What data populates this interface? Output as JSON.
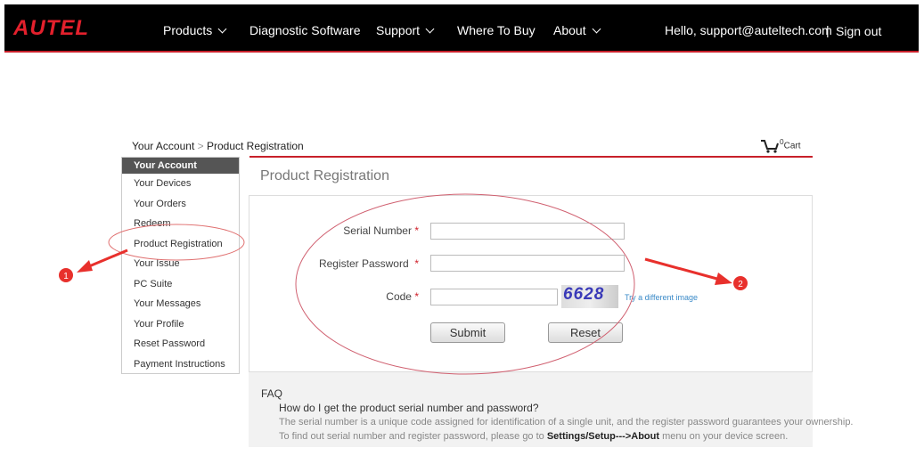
{
  "header": {
    "logo": "AUTEL",
    "nav": [
      "Products",
      "Diagnostic Software",
      "Support",
      "Where To Buy",
      "About"
    ],
    "greeting": "Hello, support@auteltech.com",
    "separator": "|",
    "signout": "Sign out"
  },
  "breadcrumb": {
    "root": "Your Account",
    "sep": ">",
    "current": "Product Registration"
  },
  "cart": {
    "count": "0",
    "label": "Cart"
  },
  "sidebar": {
    "heading": "Your Account",
    "items": [
      "Your Devices",
      "Your Orders",
      "Redeem",
      "Product Registration",
      "Your Issue",
      "PC Suite",
      "Your Messages",
      "Your Profile",
      "Reset Password",
      "Payment Instructions"
    ]
  },
  "main": {
    "title": "Product Registration",
    "serial_label": "Serial Number",
    "password_label": "Register Password",
    "code_label": "Code",
    "required": "*",
    "captcha": "6628",
    "captcha_link": "Try a different image",
    "submit": "Submit",
    "reset": "Reset"
  },
  "faq": {
    "heading": "FAQ",
    "question": "How do I get the product serial number and password?",
    "line1": "The serial number is a unique code assigned for identification of a single unit, and the register password guarantees your ownership.",
    "line2_pre": "To find out serial number and register password, please go to ",
    "line2_bold": "Settings/Setup--->About",
    "line2_post": " menu on your device screen."
  },
  "annotations": {
    "marker1": "1",
    "marker2": "2"
  },
  "colors": {
    "brand": "#e3202c",
    "header_bg": "#000000",
    "annotation": "#e8302c"
  }
}
